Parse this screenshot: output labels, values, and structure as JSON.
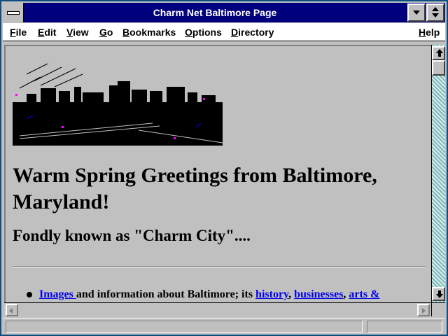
{
  "window": {
    "title": "Charm Net Baltimore Page"
  },
  "menubar": {
    "items": [
      {
        "label": "File",
        "mnemonic": "F"
      },
      {
        "label": "Edit",
        "mnemonic": "E"
      },
      {
        "label": "View",
        "mnemonic": "V"
      },
      {
        "label": "Go",
        "mnemonic": "G"
      },
      {
        "label": "Bookmarks",
        "mnemonic": "B"
      },
      {
        "label": "Options",
        "mnemonic": "O"
      },
      {
        "label": "Directory",
        "mnemonic": "D"
      },
      {
        "label": "Help",
        "mnemonic": "H"
      }
    ]
  },
  "page": {
    "heading": "Warm Spring Greetings from Baltimore, Maryland!",
    "subheading": "Fondly known as \"Charm City\"....",
    "list": {
      "item1": {
        "link_images": "Images ",
        "text1": "and information about Baltimore; its ",
        "link_history": "history",
        "sep1": ", ",
        "link_businesses": "businesses",
        "sep2": ", ",
        "link_arts": "arts &"
      }
    }
  },
  "colors": {
    "titlebar": "#00007f",
    "link": "#0000ee",
    "window_bg": "#c0c0c0",
    "scroll_track": "#7fb8b8"
  },
  "icons": {
    "system_menu": "system-menu-icon",
    "minimize": "minimize-icon",
    "maximize": "maximize-icon",
    "scroll_up": "arrow-up-icon",
    "scroll_down": "arrow-down-icon",
    "scroll_left": "arrow-left-icon",
    "scroll_right": "arrow-right-icon"
  }
}
